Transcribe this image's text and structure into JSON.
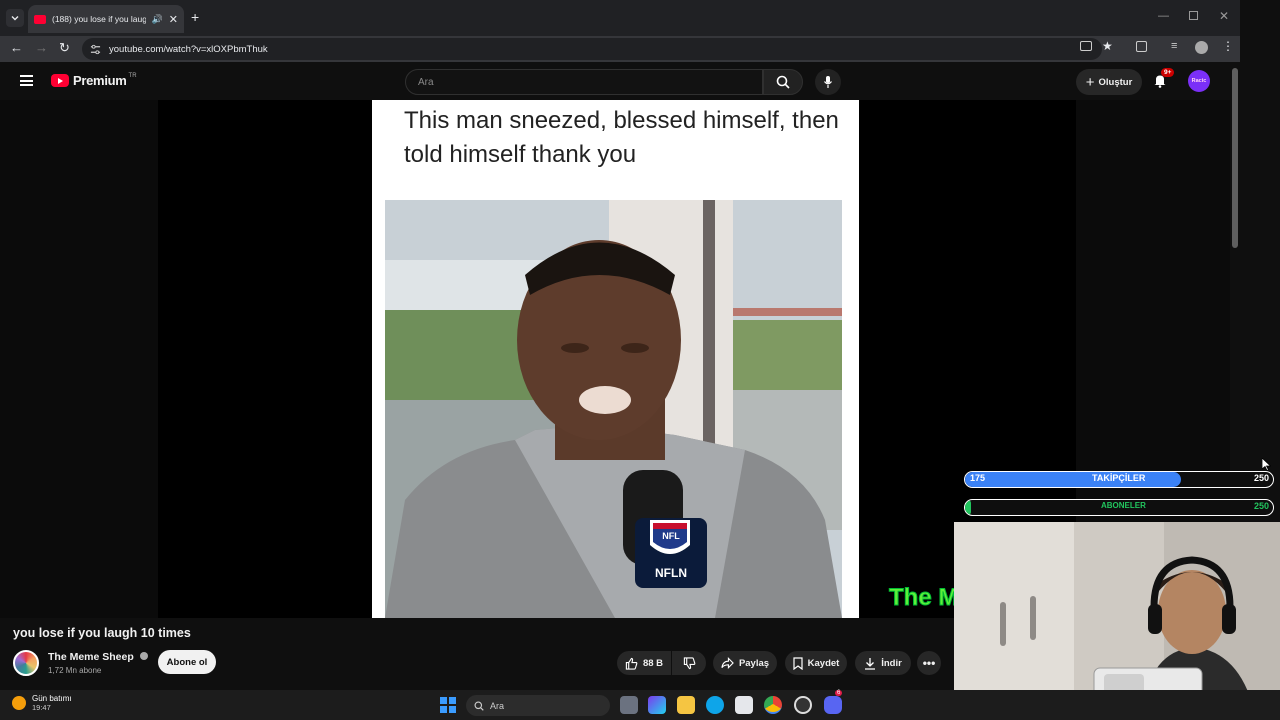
{
  "browser": {
    "tab_title": "(188) you lose if you laugh",
    "url": "youtube.com/watch?v=xlOXPbmThuk"
  },
  "youtube": {
    "logo_text": "Premium",
    "logo_region": "TR",
    "search_placeholder": "Ara",
    "create_label": "Oluştur",
    "notifications_badge": "9+",
    "avatar_label": "Racic"
  },
  "video": {
    "caption": "This man sneezed, blessed himself, then told himself thank you",
    "mic_logo": "NFLN",
    "title": "you lose if you laugh 10 times",
    "channel_name": "The Meme Sheep",
    "channel_subs": "1,72 Mn abone",
    "subscribe_label": "Abone ol",
    "likes": "88 B",
    "share_label": "Paylaş",
    "save_label": "Kaydet",
    "download_label": "İndir"
  },
  "overlay": {
    "followers": {
      "label": "TAKİPÇİLER",
      "current": "175",
      "goal": "250",
      "progress": 0.7,
      "color": "#3b82f6"
    },
    "subscribers": {
      "label": "ABONELER",
      "goal": "250",
      "progress": 0.02,
      "color": "#22c55e"
    },
    "green_text": "The M"
  },
  "taskbar": {
    "weather_label": "Gün batımı",
    "weather_time": "19:47",
    "search_label": "Ara",
    "discord_badge": "6"
  }
}
